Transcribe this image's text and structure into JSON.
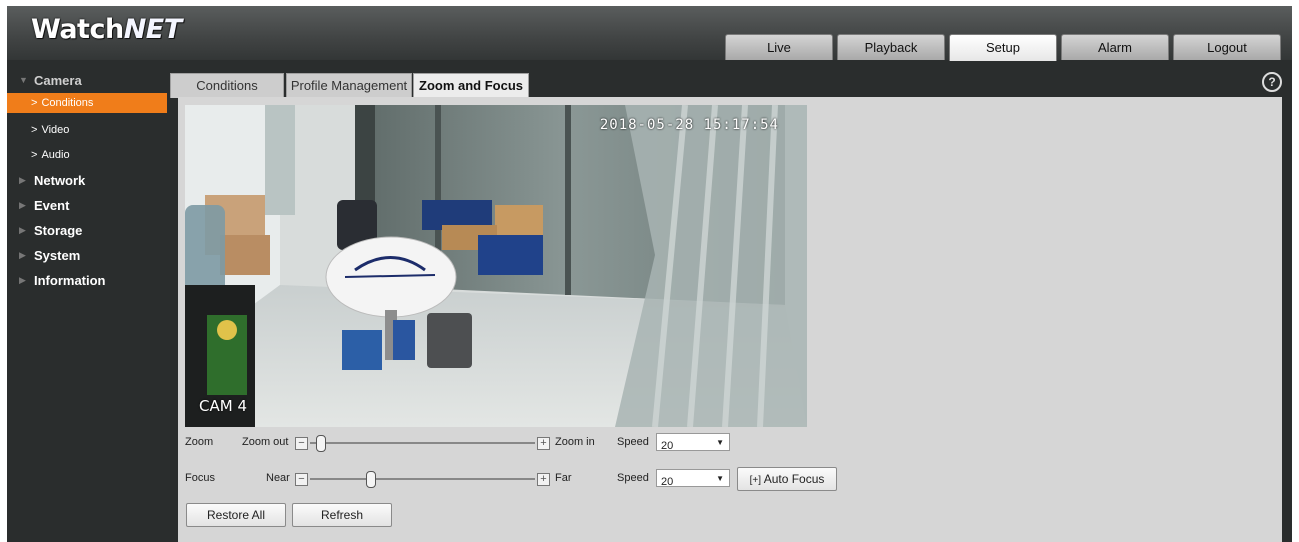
{
  "header": {
    "logo_part1": "Watch",
    "logo_part2": "NET",
    "tabs": [
      "Live",
      "Playback",
      "Setup",
      "Alarm",
      "Logout"
    ],
    "active_tab": "Setup"
  },
  "sidebar": {
    "items": [
      {
        "label": "Camera",
        "open": true
      },
      {
        "label": "Conditions",
        "sub": true,
        "active": true
      },
      {
        "label": "Video",
        "sub": true
      },
      {
        "label": "Audio",
        "sub": true
      },
      {
        "label": "Network"
      },
      {
        "label": "Event"
      },
      {
        "label": "Storage"
      },
      {
        "label": "System"
      },
      {
        "label": "Information"
      }
    ]
  },
  "subtabs": [
    "Conditions",
    "Profile Management",
    "Zoom and Focus"
  ],
  "video": {
    "timestamp": "2018-05-28 15:17:54",
    "camera_label": "CAM 4"
  },
  "zoom": {
    "label": "Zoom",
    "out_label": "Zoom out",
    "in_label": "Zoom in",
    "speed_label": "Speed",
    "speed_value": "20",
    "level": 0.05
  },
  "focus": {
    "label": "Focus",
    "near_label": "Near",
    "far_label": "Far",
    "speed_label": "Speed",
    "speed_value": "20",
    "level": 0.27,
    "auto_focus_label": "Auto Focus"
  },
  "buttons": {
    "restore_all": "Restore All",
    "refresh": "Refresh"
  },
  "colors": {
    "accent": "#f07d1a",
    "panel": "#d6d6d6",
    "frame": "#2a2d2d"
  }
}
